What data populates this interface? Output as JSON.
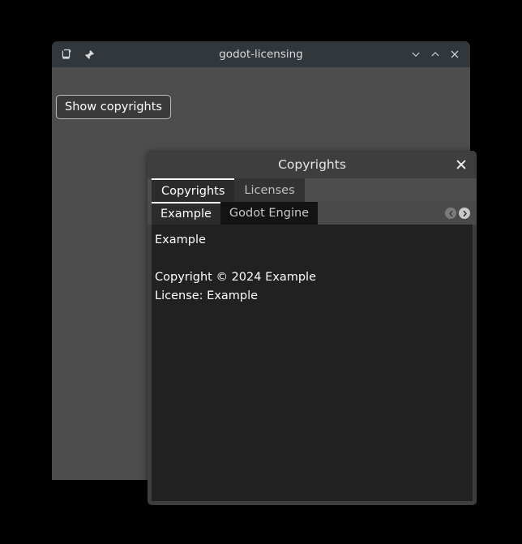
{
  "window": {
    "title": "godot-licensing",
    "icons": {
      "shade": "shade-window-icon",
      "pin": "pin-window-icon"
    },
    "controls": [
      {
        "name": "minimize-button",
        "icon": "chevron-down-icon",
        "label": ""
      },
      {
        "name": "maximize-button",
        "icon": "chevron-up-icon",
        "label": ""
      },
      {
        "name": "close-button",
        "icon": "close-icon",
        "label": ""
      }
    ]
  },
  "client": {
    "show_copyrights_label": "Show copyrights"
  },
  "dialog": {
    "title": "Copyrights",
    "close_icon": "close-icon",
    "outer_tabs": [
      {
        "label": "Copyrights",
        "active": true
      },
      {
        "label": "Licenses",
        "active": false
      }
    ],
    "inner_tabs": [
      {
        "label": "Example",
        "active": true
      },
      {
        "label": "Godot Engine",
        "active": false
      }
    ],
    "tab_nav": {
      "prev_icon": "chevron-left-circle-icon",
      "next_icon": "chevron-right-circle-icon"
    },
    "content_lines": [
      "Example",
      "",
      "Copyright © 2024 Example",
      "License: Example"
    ]
  },
  "colors": {
    "desktop": "#000000",
    "titlebar": "#31373b",
    "window_body": "#4d4d4d",
    "dialog_header": "#3e3e3e",
    "content_panel": "#212121",
    "active_tab_marker": "#ffffff",
    "inactive_inner_tab": "#131313"
  }
}
